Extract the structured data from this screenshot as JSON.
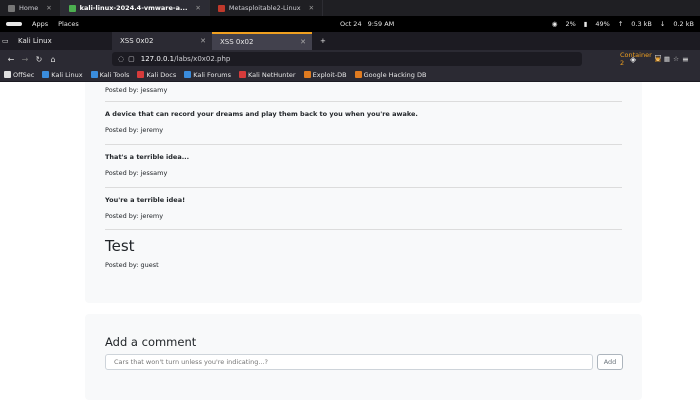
{
  "vm_tabs": [
    {
      "label": "Home"
    },
    {
      "label": "kali-linux-2024.4-vmware-a..."
    },
    {
      "label": "Metasploitable2-Linux"
    }
  ],
  "panel": {
    "apps": "Apps",
    "places": "Places",
    "date": "Oct 24",
    "time": "9:59 AM",
    "cpu": "2%",
    "battery": "49%",
    "net_up": "0.3 kB",
    "net_down": "0.2 kB"
  },
  "ff_tabs": [
    {
      "label": "Kali Linux"
    },
    {
      "label": "XSS 0x02"
    },
    {
      "label": "XSS 0x02"
    }
  ],
  "url": {
    "host": "127.0.0.1",
    "path": "/labs/x0x02.php",
    "container": "Container 2"
  },
  "bookmarks": [
    {
      "label": "OffSec",
      "color": "#e0e0e0"
    },
    {
      "label": "Kali Linux",
      "color": "#3a8cdc"
    },
    {
      "label": "Kali Tools",
      "color": "#3a8cdc"
    },
    {
      "label": "Kali Docs",
      "color": "#d63b3b"
    },
    {
      "label": "Kali Forums",
      "color": "#3a8cdc"
    },
    {
      "label": "Kali NetHunter",
      "color": "#d63b3b"
    },
    {
      "label": "Exploit-DB",
      "color": "#e07b20"
    },
    {
      "label": "Google Hacking DB",
      "color": "#e07b20"
    }
  ],
  "posts": [
    {
      "by": "Posted by: jessamy"
    },
    {
      "body": "A device that can record your dreams and play them back to you when you're awake.",
      "by": "Posted by: jeremy"
    },
    {
      "body": "That's a terrible idea...",
      "by": "Posted by: jessamy"
    },
    {
      "body": "You're a terrible idea!",
      "by": "Posted by: jeremy"
    },
    {
      "body": "Test",
      "by": "Posted by: guest"
    }
  ],
  "comment": {
    "title": "Add a comment",
    "placeholder": "Cars that won't turn unless you're indicating...?",
    "button": "Add"
  }
}
